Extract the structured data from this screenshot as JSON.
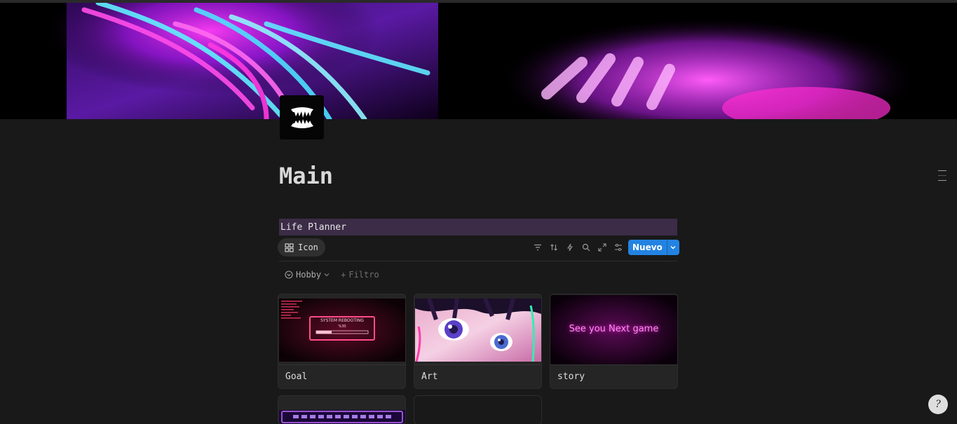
{
  "page": {
    "title": "Main"
  },
  "database": {
    "name": "Life Planner",
    "view_tab": {
      "icon": "grid-icon",
      "label": "Icon"
    },
    "toolbar": {
      "icons": [
        "filter-icon",
        "sort-icon",
        "lightning-icon",
        "search-icon",
        "expand-icon",
        "settings-sliders-icon"
      ],
      "new_label": "Nuevo"
    },
    "filters": {
      "hobby_label": "Hobby",
      "add_filter_label": "Filtro"
    },
    "cards": [
      {
        "name": "Goal",
        "thumb_text": "SYSTEM REBOOTING",
        "thumb_sub": "%30"
      },
      {
        "name": "Art"
      },
      {
        "name": "story",
        "thumb_text": "See you Next game"
      }
    ]
  },
  "colors": {
    "accent": "#2383e2",
    "db_header_bg": "#3c2c47",
    "background": "#191919"
  },
  "help_button": {
    "icon": "help-icon"
  }
}
